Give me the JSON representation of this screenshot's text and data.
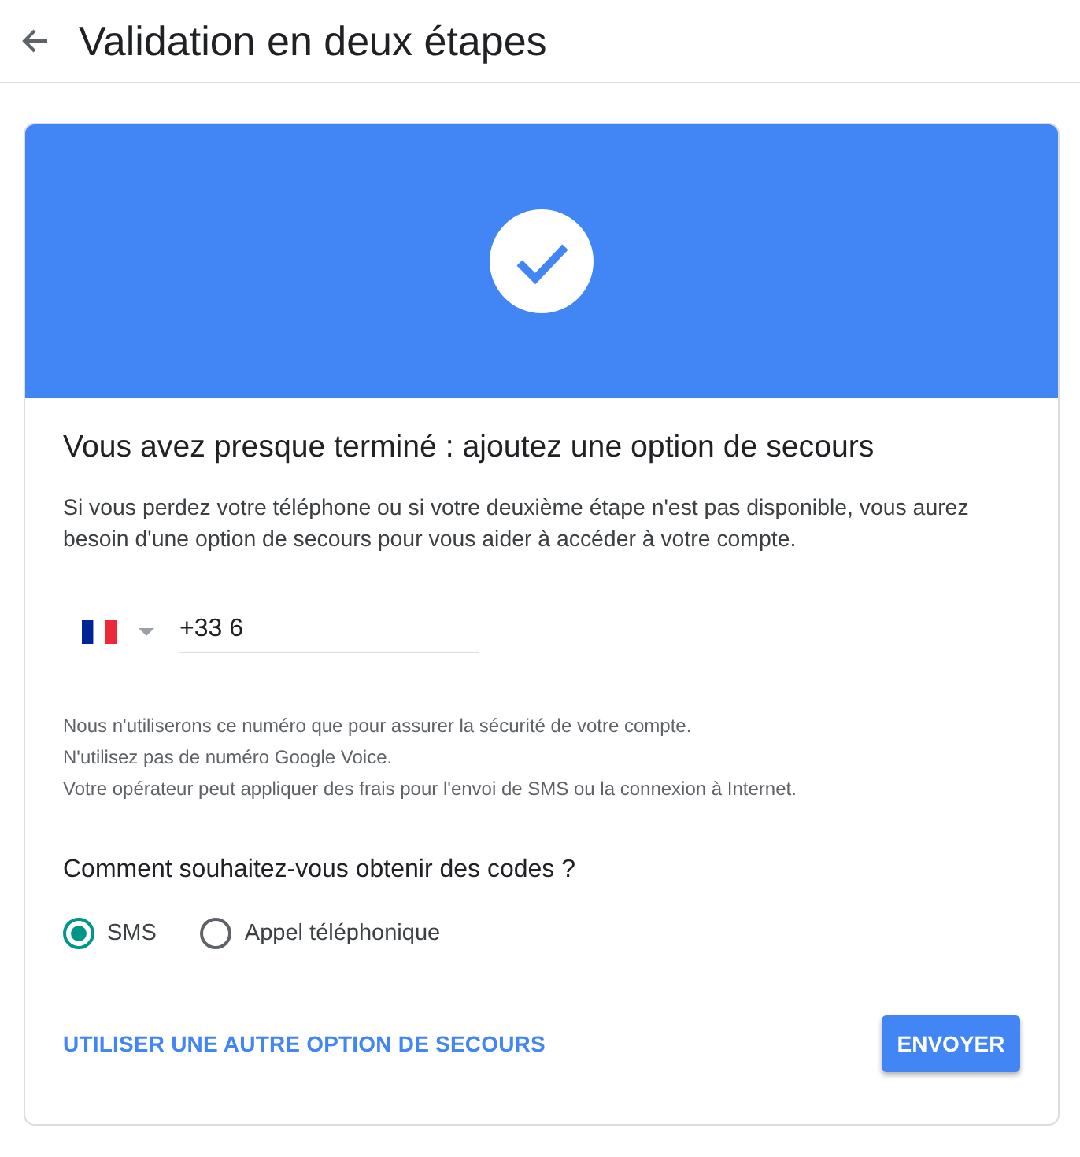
{
  "header": {
    "title": "Validation en deux étapes"
  },
  "card": {
    "heading": "Vous avez presque terminé : ajoutez une option de secours",
    "description": "Si vous perdez votre téléphone ou si votre deuxième étape n'est pas disponible, vous aurez besoin d'une option de secours pour vous aider à accéder à votre compte.",
    "phone_field": {
      "value": "+33 6"
    },
    "notes": [
      "Nous n'utiliserons ce numéro que pour assurer la sécurité de votre compte.",
      "N'utilisez pas de numéro Google Voice.",
      "Votre opérateur peut appliquer des frais pour l'envoi de SMS ou la connexion à Internet."
    ],
    "question": "Comment souhaitez-vous obtenir des codes ?",
    "delivery_options": [
      {
        "label": "SMS",
        "selected": true
      },
      {
        "label": "Appel téléphonique",
        "selected": false
      }
    ],
    "link": "UTILISER UNE AUTRE OPTION DE SECOURS",
    "button": "ENVOYER"
  }
}
